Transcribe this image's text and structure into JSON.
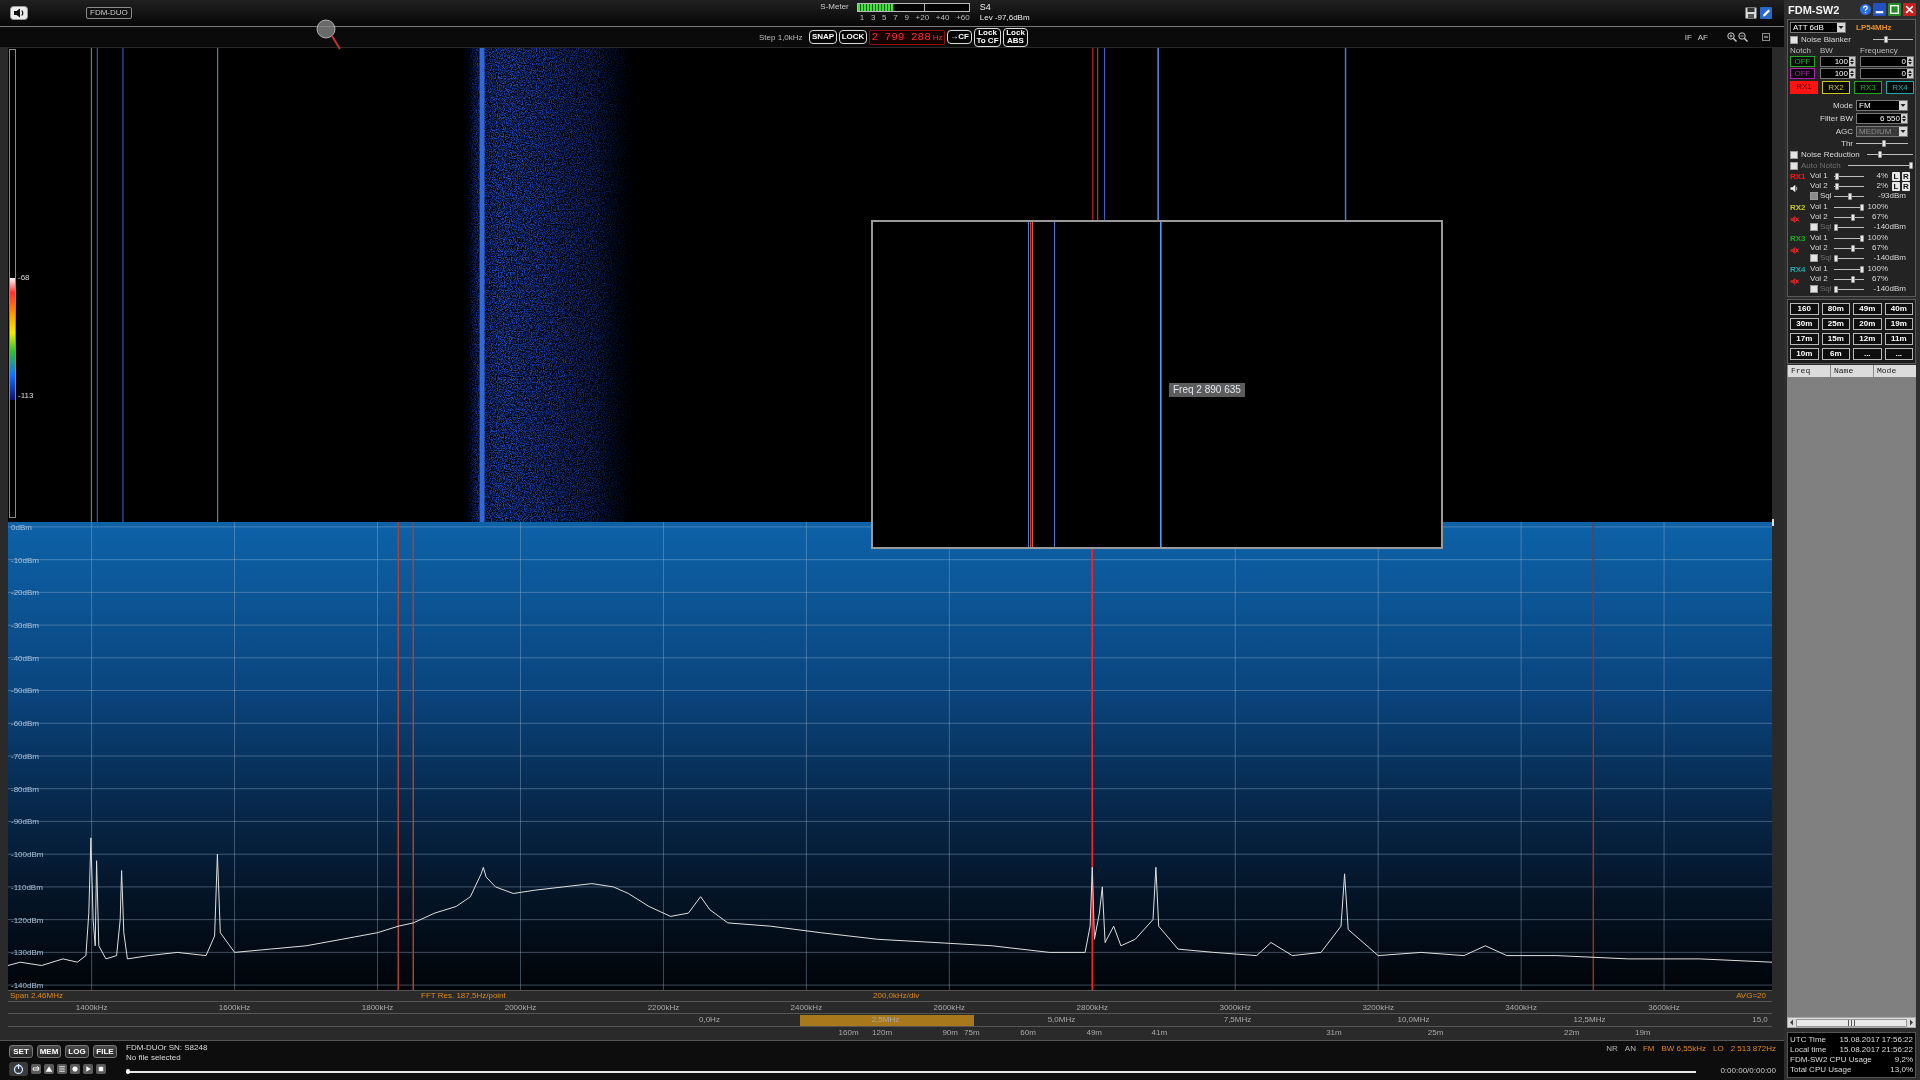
{
  "top_bar": {
    "device_button": "FDM-DUO",
    "s_meter": {
      "label": "S-Meter",
      "level": 0.33,
      "scale": [
        "1",
        "3",
        "5",
        "7",
        "9",
        "+20",
        "+40",
        "+60"
      ],
      "reading": "S4",
      "level_reading": "Lev -97,6dBm"
    }
  },
  "tuning_bar": {
    "step": "Step 1,0kHz",
    "snap": "SNAP",
    "lock": "LOCK",
    "frequency": "2 799 288",
    "unit": "Hz",
    "to_cf": "→CF",
    "lock_to_cf": "Lock To CF",
    "lock_abs": "Lock ABS",
    "view_buttons": [
      "IF",
      "AF"
    ]
  },
  "waterfall": {
    "color_scale": {
      "max": "-68",
      "min": "-113"
    },
    "zoom_window": {
      "label": "Freq 2 890 635"
    }
  },
  "spectrum": {
    "chart_data": {
      "type": "line",
      "x": [
        1283,
        1300,
        1330,
        1360,
        1380,
        1392,
        1396,
        1399,
        1402,
        1405,
        1407,
        1410,
        1420,
        1435,
        1440,
        1442,
        1445,
        1450,
        1480,
        1520,
        1560,
        1572,
        1576,
        1580,
        1600,
        1650,
        1700,
        1750,
        1800,
        1829,
        1850,
        1880,
        1910,
        1930,
        1945,
        1948,
        1952,
        1965,
        1990,
        2020,
        2060,
        2100,
        2130,
        2151,
        2180,
        2210,
        2235,
        2252,
        2265,
        2290,
        2350,
        2420,
        2500,
        2580,
        2660,
        2740,
        2790,
        2797,
        2800,
        2803,
        2810,
        2814,
        2818,
        2830,
        2840,
        2860,
        2885,
        2889,
        2893,
        2920,
        2970,
        3030,
        3050,
        3080,
        3120,
        3148,
        3153,
        3158,
        3200,
        3260,
        3320,
        3350,
        3380,
        3450,
        3550,
        3650,
        3751
      ],
      "series": [
        {
          "color": "#e0e0e0",
          "values": [
            -134,
            -133,
            -134,
            -132,
            -133,
            -131,
            -118,
            -95,
            -120,
            -128,
            -102,
            -128,
            -132,
            -131,
            -120,
            -105,
            -124,
            -132,
            -131,
            -130,
            -131,
            -125,
            -100,
            -124,
            -130,
            -129,
            -128,
            -126,
            -124,
            -122,
            -121,
            -118,
            -116,
            -113,
            -106,
            -104,
            -107,
            -110,
            -112,
            -111,
            -110,
            -109,
            -110,
            -112,
            -116,
            -119,
            -118,
            -113,
            -117,
            -121,
            -122,
            -124,
            -126,
            -127,
            -128,
            -130,
            -130,
            -122,
            -104,
            -126,
            -118,
            -110,
            -127,
            -122,
            -128,
            -126,
            -120,
            -104,
            -122,
            -129,
            -130,
            -131,
            -127,
            -131,
            -130,
            -122,
            -106,
            -123,
            -131,
            -130,
            -131,
            -128,
            -131,
            -131,
            -132,
            -132,
            -133
          ]
        }
      ],
      "xlim": [
        1283,
        3751
      ],
      "ylim": [
        -141.5,
        1.5
      ],
      "grid": true,
      "xticks": [
        {
          "value": 1400,
          "label": "1400kHz"
        },
        {
          "value": 1600,
          "label": "1600kHz"
        },
        {
          "value": 1800,
          "label": "1800kHz"
        },
        {
          "value": 2000,
          "label": "2000kHz"
        },
        {
          "value": 2200,
          "label": "2200kHz"
        },
        {
          "value": 2400,
          "label": "2400kHz"
        },
        {
          "value": 2600,
          "label": "2600kHz"
        },
        {
          "value": 2800,
          "label": "2800kHz"
        },
        {
          "value": 3000,
          "label": "3000kHz"
        },
        {
          "value": 3200,
          "label": "3200kHz"
        },
        {
          "value": 3400,
          "label": "3400kHz"
        },
        {
          "value": 3600,
          "label": "3600kHz"
        }
      ],
      "yticks": [
        {
          "value": 0,
          "label": "0dBm"
        },
        {
          "value": -10,
          "label": "-10dBm"
        },
        {
          "value": -20,
          "label": "-20dBm"
        },
        {
          "value": -30,
          "label": "-30dBm"
        },
        {
          "value": -40,
          "label": "-40dBm"
        },
        {
          "value": -50,
          "label": "-50dBm"
        },
        {
          "value": -60,
          "label": "-60dBm"
        },
        {
          "value": -70,
          "label": "-70dBm"
        },
        {
          "value": -80,
          "label": "-80dBm"
        },
        {
          "value": -90,
          "label": "-90dBm"
        },
        {
          "value": -100,
          "label": "-100dBm"
        },
        {
          "value": -110,
          "label": "-110dBm"
        },
        {
          "value": -120,
          "label": "-120dBm"
        },
        {
          "value": -130,
          "label": "-130dBm"
        },
        {
          "value": -140,
          "label": "-140dBm"
        }
      ],
      "ref_lines": [
        {
          "axis": "x",
          "value": 1829,
          "color": "#b0402a"
        },
        {
          "axis": "x",
          "value": 1850,
          "color": "#b0402a"
        },
        {
          "axis": "x",
          "value": 2800,
          "color": "#ff1e1e"
        },
        {
          "axis": "x",
          "value": 3501,
          "color": "#8a3526"
        }
      ]
    },
    "span": "Span 2.46MHz",
    "fft_resolution": "FFT Res. 187,5Hz/point",
    "scale_per_div": "200,0kHz/div",
    "averaging": "AVG=20"
  },
  "overview_scale": {
    "labels": [
      "0,0Hz",
      "2,5MHz",
      "5,0MHz",
      "7,5MHz",
      "10,0MHz",
      "12,5MHz",
      "15,0"
    ],
    "bands": [
      "160m",
      "120m",
      "90m",
      "75m",
      "60m",
      "49m",
      "41m",
      "31m",
      "25m",
      "22m",
      "19m"
    ]
  },
  "bottom_bar": {
    "buttons": [
      "SET",
      "MEM",
      "LOG",
      "FILE"
    ],
    "device": "FDM-DUOr SN: S8248",
    "file": "No file selected",
    "playback": {
      "level": 0,
      "time": "0:00:00/0:00:00"
    },
    "status": [
      {
        "text": "NR",
        "on": false
      },
      {
        "text": "AN",
        "on": false
      },
      {
        "text": "FM",
        "on": true
      },
      {
        "text": "BW 6,55kHz",
        "on": true
      },
      {
        "text": "LO",
        "on": true
      },
      {
        "text": "2 513 872Hz",
        "on": true
      }
    ]
  },
  "control_panel": {
    "title": "FDM-SW2",
    "attenuator": "ATT 6dB",
    "input_filter": "LP54MHz",
    "noise_blanker": {
      "label": "Noise Blanker",
      "checked": false,
      "level": 0.3
    },
    "notch": {
      "headers": [
        "Notch",
        "BW",
        "Frequency"
      ],
      "rows": [
        {
          "state": "OFF",
          "color": "#1fae1f",
          "bw": "100",
          "frequency": "0"
        },
        {
          "state": "OFF",
          "color": "#b01fb0",
          "bw": "100",
          "frequency": "0"
        }
      ]
    },
    "receivers": [
      {
        "label": "RX1",
        "color": "#ff1414",
        "selected": true
      },
      {
        "label": "RX2",
        "color": "#c8c81e",
        "selected": false
      },
      {
        "label": "RX3",
        "color": "#1eaa1e",
        "selected": false
      },
      {
        "label": "RX4",
        "color": "#1eaaaa",
        "selected": false
      }
    ],
    "mode": {
      "label": "Mode",
      "value": "FM"
    },
    "filter_bw": {
      "label": "Filter BW",
      "value": "6 550"
    },
    "agc": {
      "label": "AGC",
      "value": "MEDIUM",
      "disabled": true
    },
    "threshold": {
      "label": "Thr",
      "level": 0.54
    },
    "noise_reduction": {
      "label": "Noise Reduction",
      "checked": false,
      "disabled": false,
      "level": 0.27
    },
    "auto_notch": {
      "label": "Auto Notch",
      "checked": false,
      "disabled": true,
      "level": 1
    },
    "channels": [
      {
        "label": "RX1",
        "color": "#ff1414",
        "muted": false,
        "volumes": [
          {
            "label": "Vol 1",
            "level": 0.04,
            "reading": "4%",
            "balance": [
              "L",
              "R"
            ]
          },
          {
            "label": "Vol 2",
            "level": 0.02,
            "reading": "2%",
            "balance": [
              "L",
              "R"
            ]
          }
        ],
        "squelch": {
          "label": "Sql",
          "checked": false,
          "disabled": false,
          "level": 0.54,
          "reading": "-93dBm"
        }
      },
      {
        "label": "RX2",
        "color": "#c8c81e",
        "muted": true,
        "volumes": [
          {
            "label": "Vol 1",
            "level": 1,
            "reading": "100%"
          },
          {
            "label": "Vol 2",
            "level": 0.67,
            "reading": "67%"
          }
        ],
        "squelch": {
          "label": "Sql",
          "checked": false,
          "disabled": true,
          "level": 0,
          "reading": "-140dBm"
        }
      },
      {
        "label": "RX3",
        "color": "#1eaa1e",
        "muted": true,
        "volumes": [
          {
            "label": "Vol 1",
            "level": 1,
            "reading": "100%"
          },
          {
            "label": "Vol 2",
            "level": 0.67,
            "reading": "67%"
          }
        ],
        "squelch": {
          "label": "Sql",
          "checked": false,
          "disabled": true,
          "level": 0,
          "reading": "-140dBm"
        }
      },
      {
        "label": "RX4",
        "color": "#1eaaaa",
        "muted": true,
        "volumes": [
          {
            "label": "Vol 1",
            "level": 1,
            "reading": "100%"
          },
          {
            "label": "Vol 2",
            "level": 0.67,
            "reading": "67%"
          }
        ],
        "squelch": {
          "label": "Sql",
          "checked": false,
          "disabled": true,
          "level": 0,
          "reading": "-140dBm"
        }
      }
    ],
    "bands": [
      "160",
      "80m",
      "49m",
      "40m",
      "30m",
      "25m",
      "20m",
      "19m",
      "17m",
      "15m",
      "12m",
      "11m",
      "10m",
      "6m",
      "...",
      "..."
    ],
    "memory_table": {
      "columns": [
        "Freq",
        "Name",
        "Mode"
      ]
    },
    "status": [
      {
        "label": "UTC Time",
        "value": "15.08.2017 17:56:22"
      },
      {
        "label": "Local time",
        "value": "15.08.2017 21:56:22"
      },
      {
        "label": "FDM-SW2 CPU Usage",
        "value": "9,2%"
      },
      {
        "label": "Total CPU Usage",
        "value": "13,0%"
      }
    ]
  }
}
